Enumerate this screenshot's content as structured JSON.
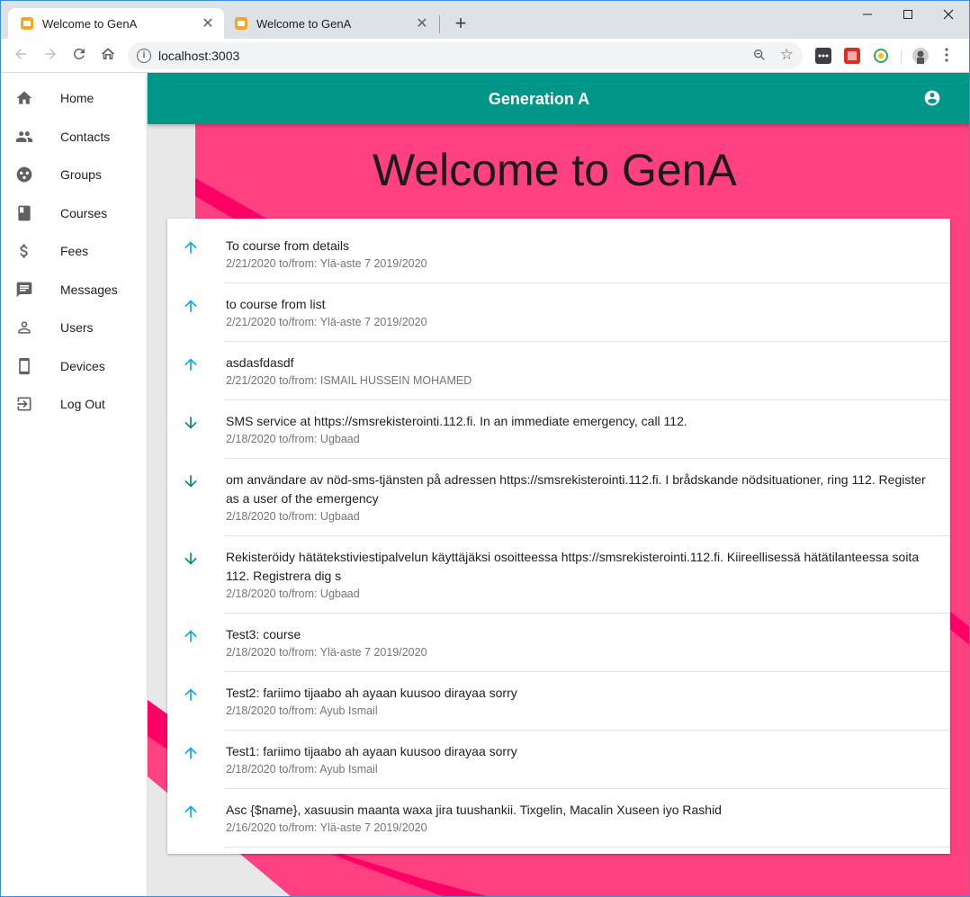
{
  "browser": {
    "tabs": [
      {
        "title": "Welcome to GenA",
        "active": true
      },
      {
        "title": "Welcome to GenA",
        "active": false
      }
    ],
    "new_tab": "+",
    "url": "localhost:3003",
    "window_controls": {
      "minimize": "—",
      "maximize": "☐",
      "close": "✕"
    }
  },
  "sidebar": {
    "items": [
      {
        "label": "Home",
        "icon": "home-icon"
      },
      {
        "label": "Contacts",
        "icon": "contacts-icon"
      },
      {
        "label": "Groups",
        "icon": "groups-icon"
      },
      {
        "label": "Courses",
        "icon": "book-icon"
      },
      {
        "label": "Fees",
        "icon": "dollar-icon"
      },
      {
        "label": "Messages",
        "icon": "message-icon"
      },
      {
        "label": "Users",
        "icon": "person-icon"
      },
      {
        "label": "Devices",
        "icon": "phone-icon"
      },
      {
        "label": "Log Out",
        "icon": "logout-icon"
      }
    ]
  },
  "appbar": {
    "title": "Generation A",
    "account_icon": "account-circle-icon"
  },
  "main": {
    "heading": "Welcome to GenA",
    "messages": [
      {
        "direction": "up",
        "text": "To course from details",
        "meta": "2/21/2020 to/from: Ylä-aste 7 2019/2020"
      },
      {
        "direction": "up",
        "text": "to course from list",
        "meta": "2/21/2020 to/from: Ylä-aste 7 2019/2020"
      },
      {
        "direction": "up",
        "text": "asdasfdasdf",
        "meta": "2/21/2020 to/from: ISMAIL HUSSEIN MOHAMED"
      },
      {
        "direction": "down",
        "text": "SMS service at https://smsrekisterointi.112.fi. In an immediate emergency, call 112.",
        "meta": "2/18/2020 to/from: Ugbaad"
      },
      {
        "direction": "down",
        "text": "om användare av nöd-sms-tjänsten på adressen https://smsrekisterointi.112.fi. I brådskande nödsituationer, ring 112. Register as a user of the emergency",
        "meta": "2/18/2020 to/from: Ugbaad"
      },
      {
        "direction": "down",
        "text": "Rekisteröidy hätätekstiviestipalvelun käyttäjäksi osoitteessa https://smsrekisterointi.112.fi. Kiireellisessä hätätilanteessa soita 112. Registrera dig s",
        "meta": "2/18/2020 to/from: Ugbaad"
      },
      {
        "direction": "up",
        "text": "Test3: course",
        "meta": "2/18/2020 to/from: Ylä-aste 7 2019/2020"
      },
      {
        "direction": "up",
        "text": "Test2: fariimo tijaabo ah ayaan kuusoo dirayaa sorry",
        "meta": "2/18/2020 to/from: Ayub Ismail"
      },
      {
        "direction": "up",
        "text": "Test1: fariimo tijaabo ah ayaan kuusoo dirayaa sorry",
        "meta": "2/18/2020 to/from: Ayub Ismail"
      },
      {
        "direction": "up",
        "text": "Asc {$name}, xasuusin maanta waxa jira tuushankii. Tixgelin, Macalin Xuseen iyo Rashid",
        "meta": "2/16/2020 to/from: Ylä-aste 7 2019/2020"
      }
    ]
  },
  "colors": {
    "appbar": "#009688",
    "pink": "#ff4081",
    "pink_dark": "#ff0066",
    "arrow_up": "#03a9f4",
    "arrow_down": "#00897b"
  }
}
